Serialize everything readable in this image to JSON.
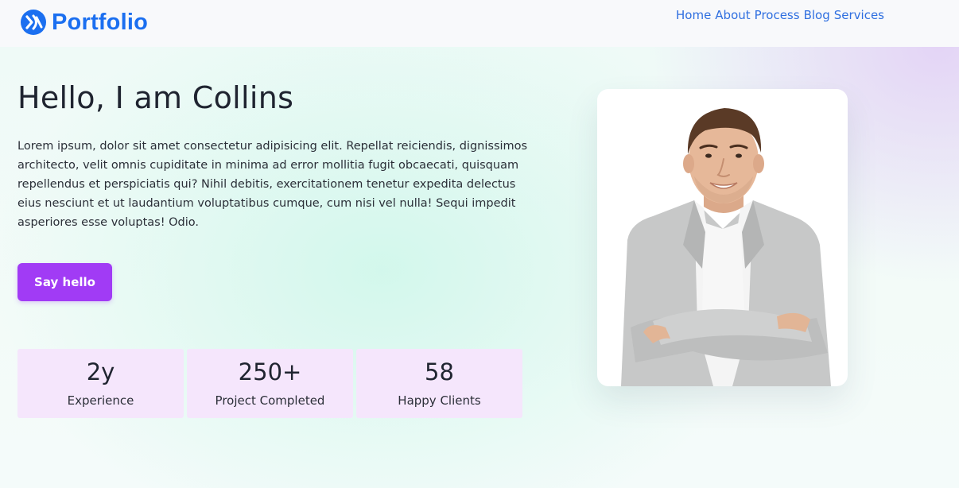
{
  "header": {
    "brand": "Portfolio",
    "nav": [
      "Home",
      "About",
      "Process",
      "Blog",
      "Services"
    ]
  },
  "hero": {
    "title": "Hello, I am Collins",
    "text": "Lorem ipsum, dolor sit amet consectetur adipisicing elit. Repellat reiciendis, dignissimos architecto, velit omnis cupiditate in minima ad error mollitia fugit obcaecati, quisquam repellendus et perspiciatis qui? Nihil debitis, exercitationem tenetur expedita delectus eius nesciunt et ut laudantium voluptatibus cumque, cum nisi vel nulla! Sequi impedit asperiores esse voluptas! Odio.",
    "button": "Say hello"
  },
  "stats": [
    {
      "value": "2y",
      "label": "Experience"
    },
    {
      "value": "250+",
      "label": "Project Completed"
    },
    {
      "value": "58",
      "label": "Happy Clients"
    }
  ],
  "colors": {
    "brand": "#1b6ff0",
    "button": "#a13bf5",
    "stat_card": "#f5e6fc"
  },
  "icons": {
    "brand": "brand-logo-icon"
  }
}
